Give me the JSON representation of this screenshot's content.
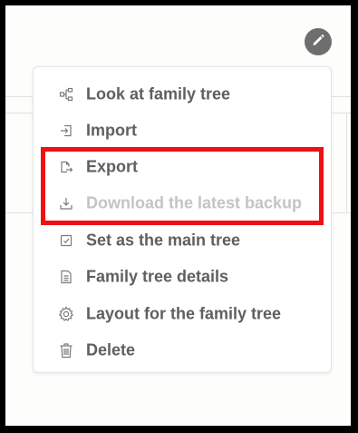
{
  "edit": {
    "icon": "pencil-icon"
  },
  "menu": {
    "items": [
      {
        "label": "Look at family tree",
        "icon": "tree-structure-icon",
        "disabled": false
      },
      {
        "label": "Import",
        "icon": "import-icon",
        "disabled": false
      },
      {
        "label": "Export",
        "icon": "export-icon",
        "disabled": false
      },
      {
        "label": "Download the latest backup",
        "icon": "download-icon",
        "disabled": true
      },
      {
        "label": "Set as the main tree",
        "icon": "checkbox-icon",
        "disabled": false
      },
      {
        "label": "Family tree details",
        "icon": "document-icon",
        "disabled": false
      },
      {
        "label": "Layout for the family tree",
        "icon": "gear-icon",
        "disabled": false
      },
      {
        "label": "Delete",
        "icon": "trash-icon",
        "disabled": false
      }
    ]
  },
  "colors": {
    "highlight": "#ee1111",
    "text": "#5f5f5f",
    "disabled_text": "#c4c4c4",
    "edit_button": "#6e6e6e"
  }
}
